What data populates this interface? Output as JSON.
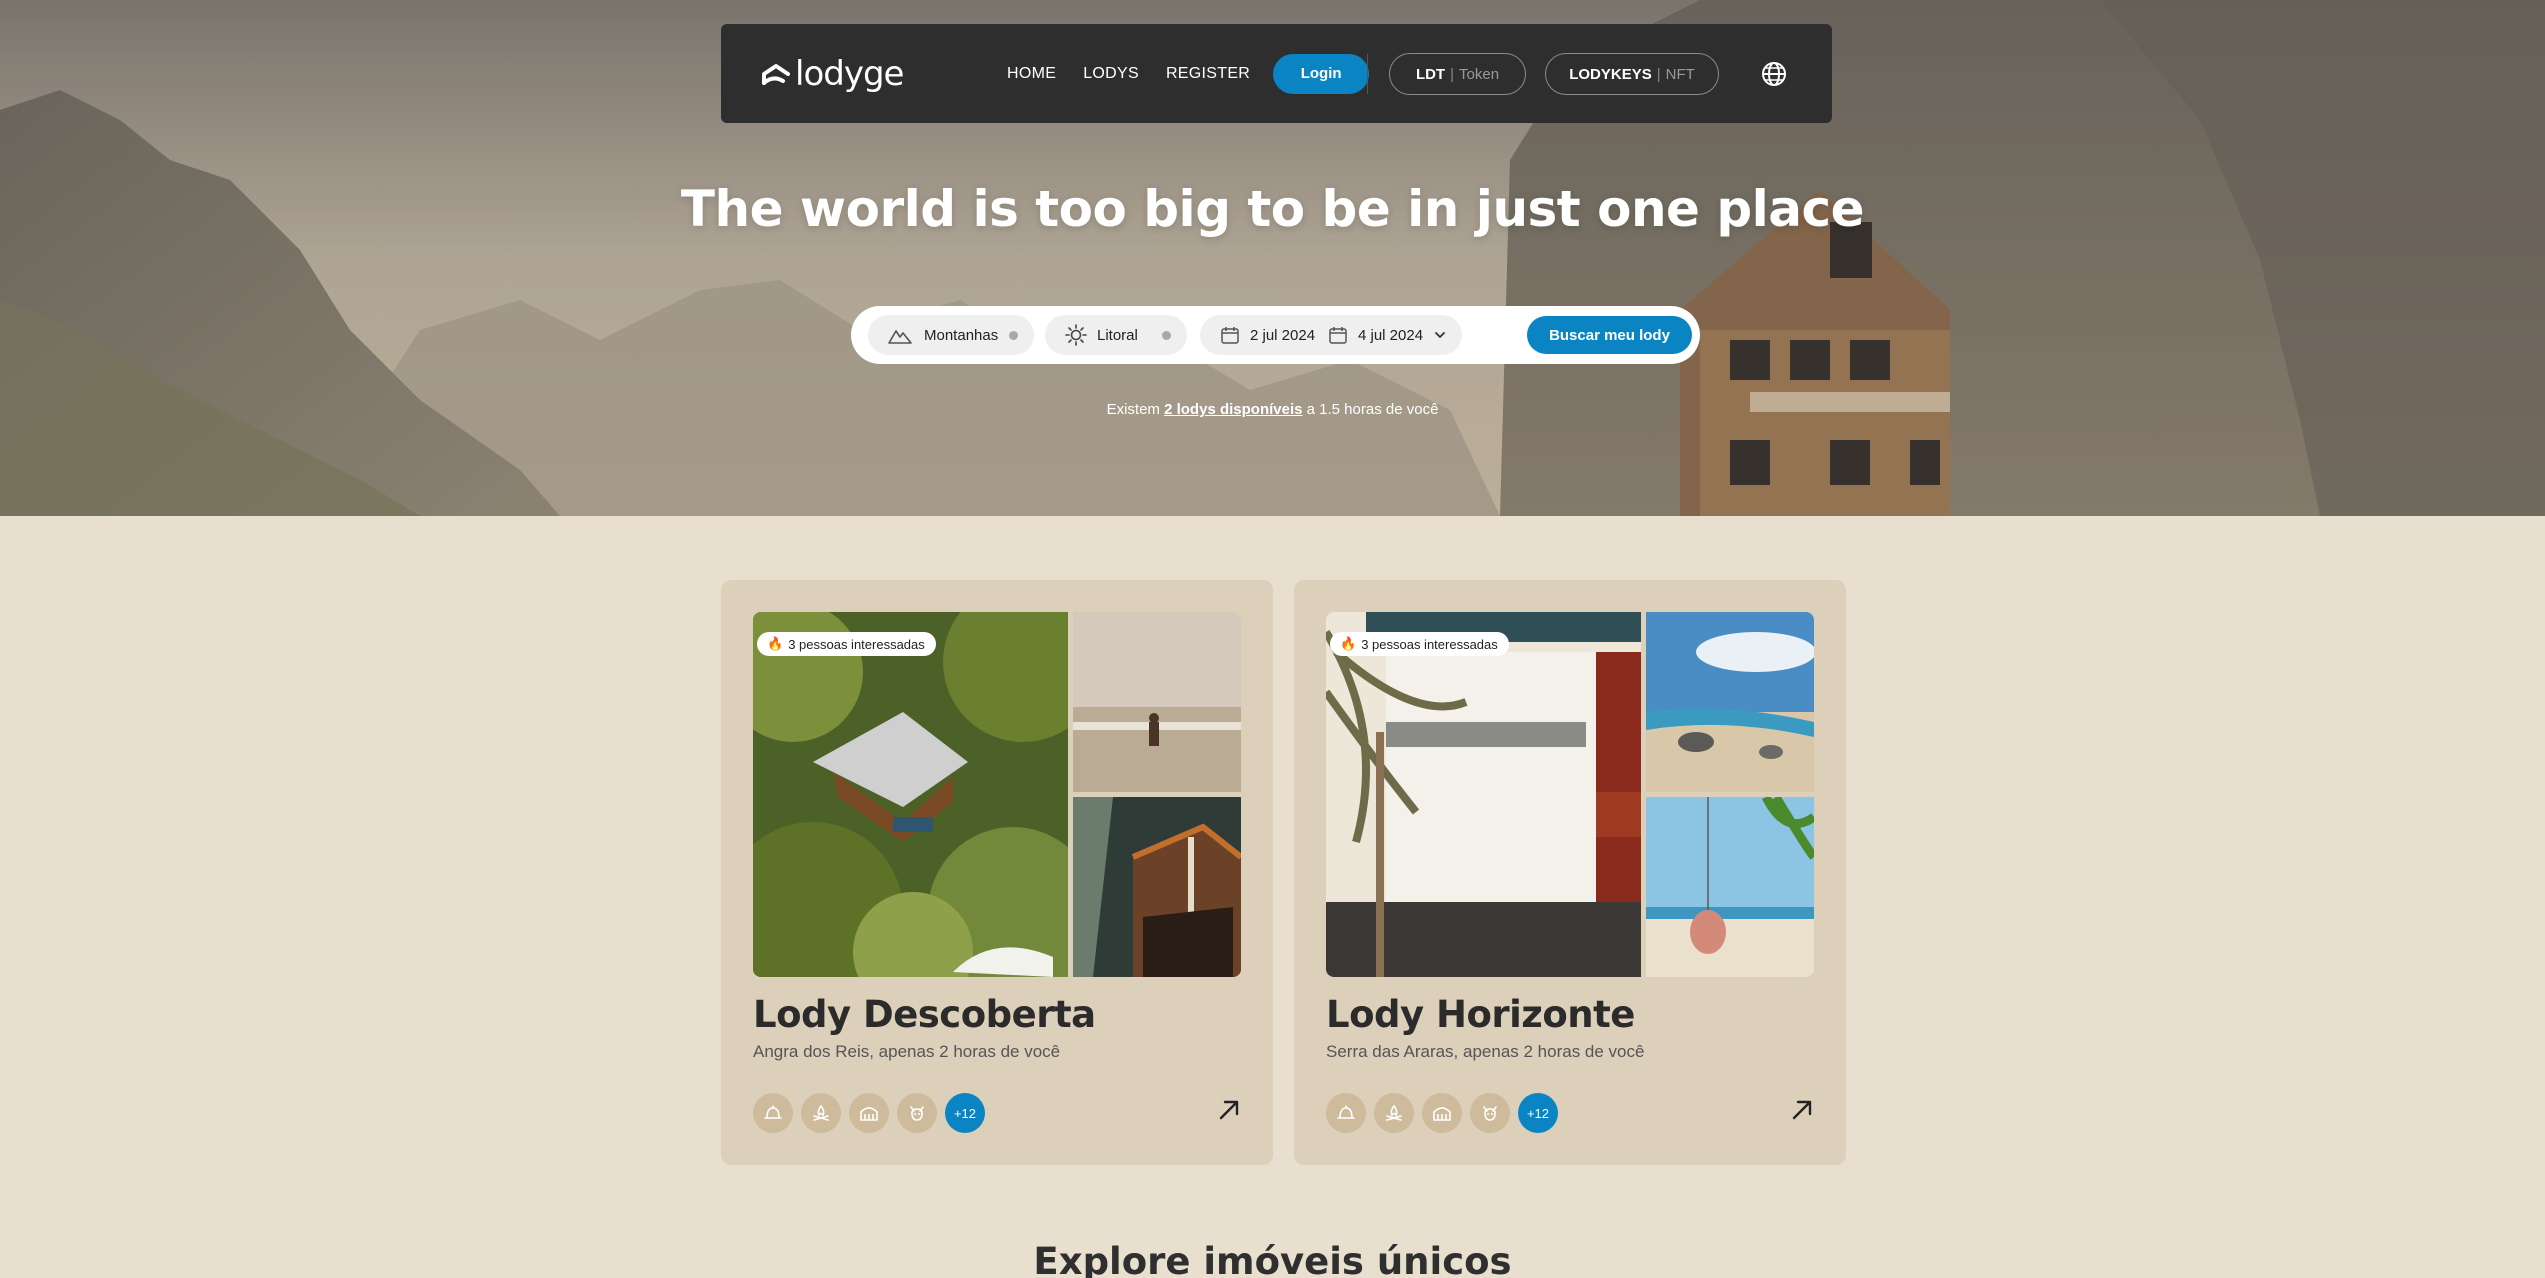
{
  "brand": {
    "logo_text": "lodyge"
  },
  "nav": {
    "links": [
      "HOME",
      "LODYS",
      "REGISTER"
    ],
    "login_label": "Login",
    "token_button": {
      "strong": "LDT",
      "divider": "|",
      "muted": "Token"
    },
    "nft_button": {
      "strong": "LODYKEYS",
      "divider": "|",
      "muted": "NFT"
    },
    "language_icon": "globe-icon"
  },
  "hero": {
    "title": "The world is too big to be in just one place",
    "search": {
      "filter_1": "Montanhas",
      "filter_1_icon": "mountain-icon",
      "filter_2": "Litoral",
      "filter_2_icon": "sun-icon",
      "date_from": "2 jul 2024",
      "date_to": "4 jul 2024",
      "button_label": "Buscar meu lody"
    },
    "availability": {
      "prefix": "Existem ",
      "link": "2 lodys disponíveis",
      "suffix": " a 1.5 horas de você"
    }
  },
  "cards": [
    {
      "badge": "3 pessoas interessadas",
      "title": "Lody Descoberta",
      "subtitle": "Angra dos Reis, apenas 2 horas de você",
      "amenities": [
        "cloche-icon",
        "campfire-icon",
        "cabin-icon",
        "pet-icon"
      ],
      "more_label": "+12"
    },
    {
      "badge": "3 pessoas interessadas",
      "title": "Lody Horizonte",
      "subtitle": "Serra das Araras, apenas 2 horas de você",
      "amenities": [
        "cloche-icon",
        "campfire-icon",
        "cabin-icon",
        "pet-icon"
      ],
      "more_label": "+12"
    }
  ],
  "sections": {
    "explore_title": "Explore imóveis únicos"
  },
  "colors": {
    "accent": "#0b84c4",
    "background": "#e9dfcf",
    "card": "#ddd0bb",
    "navbar": "#2e2e2e"
  }
}
